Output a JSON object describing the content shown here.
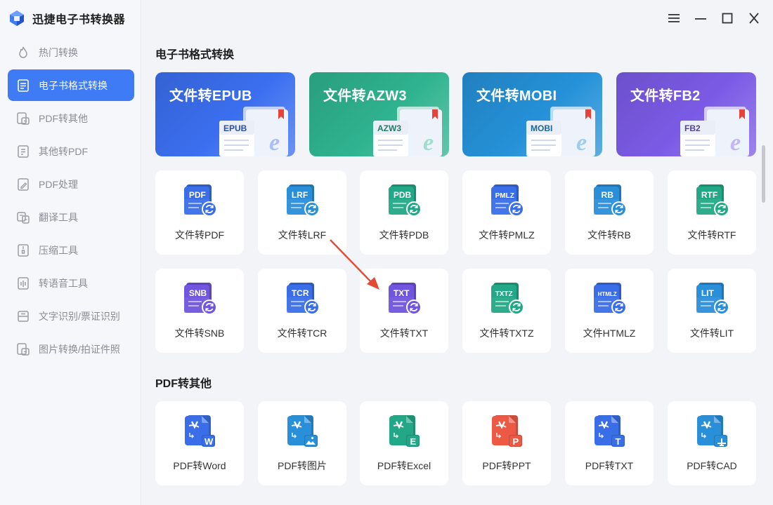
{
  "app": {
    "title": "迅捷电子书转换器"
  },
  "sidebar": {
    "items": [
      {
        "label": "热门转换",
        "icon": "flame-icon"
      },
      {
        "label": "电子书格式转换",
        "icon": "ebook-icon",
        "active": true
      },
      {
        "label": "PDF转其他",
        "icon": "pdf-convert-icon"
      },
      {
        "label": "其他转PDF",
        "icon": "to-pdf-icon"
      },
      {
        "label": "PDF处理",
        "icon": "pdf-edit-icon"
      },
      {
        "label": "翻译工具",
        "icon": "translate-icon"
      },
      {
        "label": "压缩工具",
        "icon": "compress-icon"
      },
      {
        "label": "转语音工具",
        "icon": "voice-icon"
      },
      {
        "label": "文字识别/票证识别",
        "icon": "ocr-icon"
      },
      {
        "label": "图片转换/拍证件照",
        "icon": "image-convert-icon"
      }
    ]
  },
  "window_controls": [
    "menu-icon",
    "minimize-icon",
    "maximize-icon",
    "close-icon"
  ],
  "sections": {
    "ebook": {
      "title": "电子书格式转换",
      "banners": [
        {
          "title": "文件转EPUB",
          "tag": "EPUB",
          "color": "#3b6ff0"
        },
        {
          "title": "文件转AZW3",
          "tag": "AZW3",
          "color": "#2fb38f"
        },
        {
          "title": "文件转MOBI",
          "tag": "MOBI",
          "color": "#2591d8"
        },
        {
          "title": "文件转FB2",
          "tag": "FB2",
          "color": "#7b5be6"
        }
      ],
      "cards_row1": [
        {
          "label": "文件转PDF",
          "tag": "PDF",
          "color": "#3a6ee8"
        },
        {
          "label": "文件转LRF",
          "tag": "LRF",
          "color": "#2a8fd9"
        },
        {
          "label": "文件转PDB",
          "tag": "PDB",
          "color": "#22a886"
        },
        {
          "label": "文件转PMLZ",
          "tag": "PMLZ",
          "color": "#3a6ee8"
        },
        {
          "label": "文件转RB",
          "tag": "RB",
          "color": "#2a8fd9"
        },
        {
          "label": "文件转RTF",
          "tag": "RTF",
          "color": "#22a886"
        }
      ],
      "cards_row2": [
        {
          "label": "文件转SNB",
          "tag": "SNB",
          "color": "#7055df"
        },
        {
          "label": "文件转TCR",
          "tag": "TCR",
          "color": "#3a6ee8"
        },
        {
          "label": "文件转TXT",
          "tag": "TXT",
          "color": "#7055df"
        },
        {
          "label": "文件转TXTZ",
          "tag": "TXTZ",
          "color": "#22a886"
        },
        {
          "label": "文件HTMLZ",
          "tag": "HTMLZ",
          "color": "#3a6ee8"
        },
        {
          "label": "文件转LIT",
          "tag": "LIT",
          "color": "#2a8fd9"
        }
      ]
    },
    "pdf_other": {
      "title": "PDF转其他",
      "cards": [
        {
          "label": "PDF转Word",
          "badge": "W",
          "color": "#3a6ee8"
        },
        {
          "label": "PDF转图片",
          "badge": "image",
          "color": "#2a8fd9"
        },
        {
          "label": "PDF转Excel",
          "badge": "E",
          "color": "#22a886"
        },
        {
          "label": "PDF转PPT",
          "badge": "P",
          "color": "#ec5a45"
        },
        {
          "label": "PDF转TXT",
          "badge": "T",
          "color": "#3a6ee8"
        },
        {
          "label": "PDF转CAD",
          "badge": "cad",
          "color": "#2a8fd9"
        }
      ]
    }
  }
}
